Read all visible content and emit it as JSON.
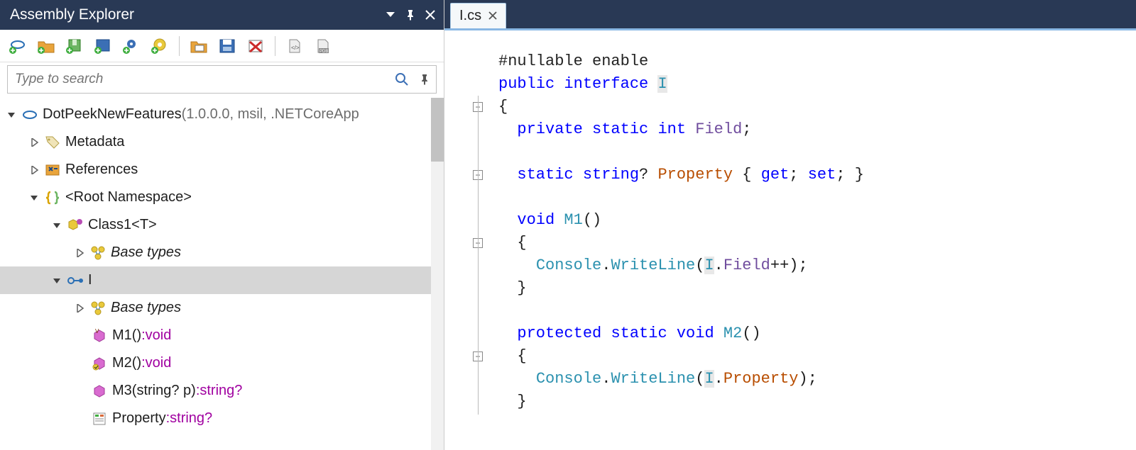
{
  "panel": {
    "title": "Assembly Explorer"
  },
  "search": {
    "placeholder": "Type to search"
  },
  "tree": {
    "assembly_name": "DotPeekNewFeatures",
    "assembly_suffix": " (1.0.0.0, msil, .NETCoreApp",
    "metadata": "Metadata",
    "references": "References",
    "root_ns": "<Root Namespace>",
    "class1": "Class1<T>",
    "base_types": "Base types",
    "iface": "I",
    "m1_name": "M1()",
    "m1_ret": ":void",
    "m2_name": "M2()",
    "m2_ret": ":void",
    "m3_name": "M3(string? p)",
    "m3_ret": ":string?",
    "prop_name": "Property",
    "prop_ret": ":string?"
  },
  "tab": {
    "label": "I.cs"
  },
  "code": {
    "l1_directive": "#nullable enable",
    "l2_kw1": "public",
    "l2_kw2": "interface",
    "l2_name": "I",
    "l3": "{",
    "l4_kw1": "private",
    "l4_kw2": "static",
    "l4_kw3": "int",
    "l4_name": "Field",
    "l4_end": ";",
    "l6_kw1": "static",
    "l6_kw2": "string",
    "l6_q": "?",
    "l6_name": "Property",
    "l6_b1": " { ",
    "l6_get": "get",
    "l6_sc1": "; ",
    "l6_set": "set",
    "l6_sc2": "; ",
    "l6_b2": "}",
    "l8_kw1": "void",
    "l8_name": "M1",
    "l8_par": "()",
    "l9": "{",
    "l10_obj": "Console",
    "l10_dot1": ".",
    "l10_wl": "WriteLine",
    "l10_op": "(",
    "l10_I": "I",
    "l10_dot2": ".",
    "l10_f": "Field",
    "l10_inc": "++);",
    "l11": "}",
    "l13_kw1": "protected",
    "l13_kw2": "static",
    "l13_kw3": "void",
    "l13_name": "M2",
    "l13_par": "()",
    "l14": "{",
    "l15_obj": "Console",
    "l15_dot1": ".",
    "l15_wl": "WriteLine",
    "l15_op": "(",
    "l15_I": "I",
    "l15_dot2": ".",
    "l15_p": "Property",
    "l15_end": ");",
    "l16": "}"
  }
}
